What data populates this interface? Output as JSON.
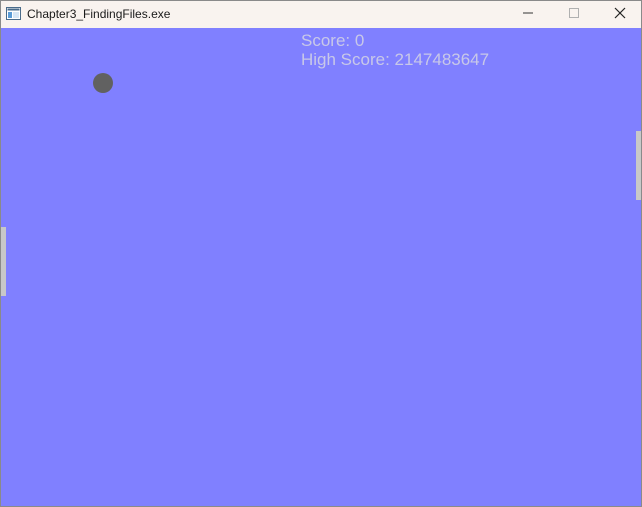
{
  "window": {
    "title": "Chapter3_FindingFiles.exe"
  },
  "icons": {
    "app": "app-window-icon",
    "minimize": "minimize-icon",
    "maximize": "maximize-icon",
    "close": "close-icon"
  },
  "colors": {
    "game_background": "#8080ff",
    "ball": "#616161",
    "paddle": "#c8c8c8",
    "hud_text": "#c8c8e8",
    "titlebar": "#f9f3ef"
  },
  "hud": {
    "score": "Score: 0",
    "high_score": "High Score: 2147483647"
  }
}
